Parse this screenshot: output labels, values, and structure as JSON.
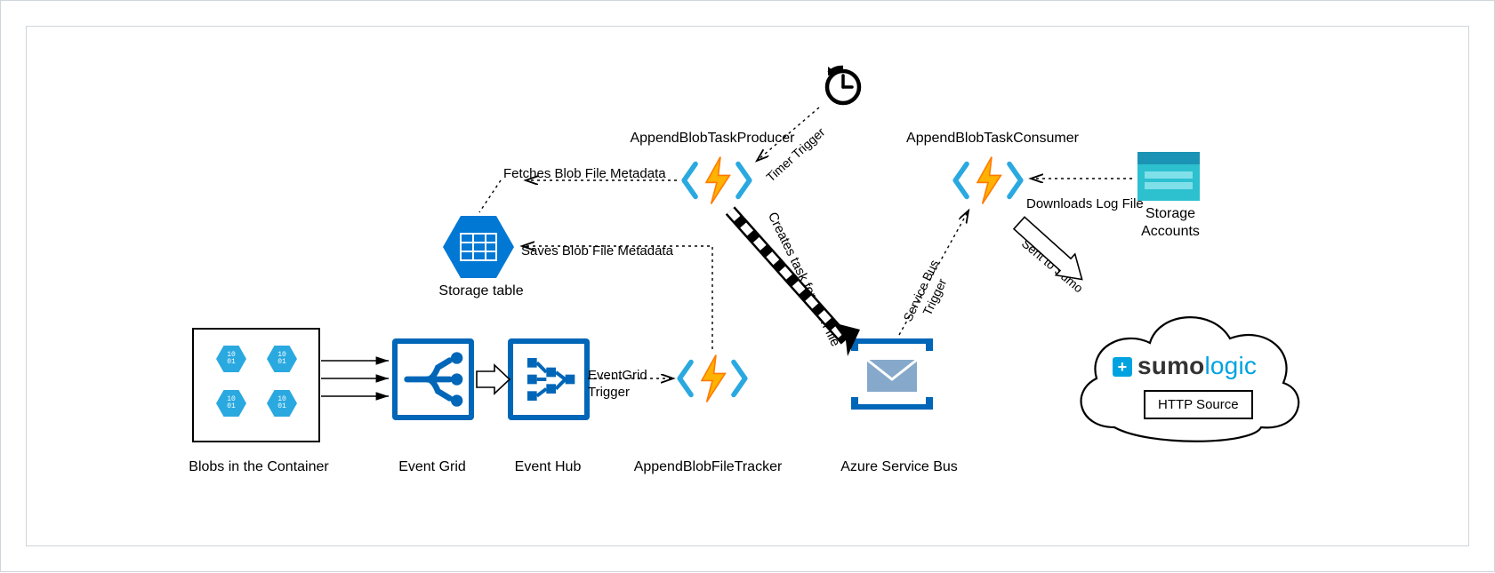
{
  "labels": {
    "blobs_container": "Blobs in the Container",
    "event_grid": "Event Grid",
    "event_hub": "Event Hub",
    "append_blob_file_tracker": "AppendBlobFileTracker",
    "azure_service_bus": "Azure Service Bus",
    "append_blob_task_producer": "AppendBlobTaskProducer",
    "append_blob_task_consumer": "AppendBlobTaskConsumer",
    "storage_table": "Storage table",
    "storage_accounts": "Storage\nAccounts",
    "http_source": "HTTP Source",
    "sumo_brand": "sumo",
    "sumo_logic": "logic"
  },
  "edge_labels": {
    "eventgrid_trigger": "EventGrid\nTrigger",
    "fetches_metadata": "Fetches Blob File Metadata",
    "saves_metadata": "Saves Blob File Metadata",
    "timer_trigger": "Timer Trigger",
    "creates_task": "Creates task for each file",
    "service_bus_trigger": "Service Bus\nTrigger",
    "downloads_log_file": "Downloads Log File",
    "sent_to_sumo": "Sent to Sumo"
  },
  "colors": {
    "azure_blue": "#0078d4",
    "border_blue": "#0066b8",
    "light_blue": "#2aa9e0",
    "teal": "#2dc0cf",
    "envelope": "#86a9cb",
    "bolt_yellow": "#ffb200",
    "bolt_orange": "#ff7a00",
    "sumo_blue": "#00a3e0"
  }
}
